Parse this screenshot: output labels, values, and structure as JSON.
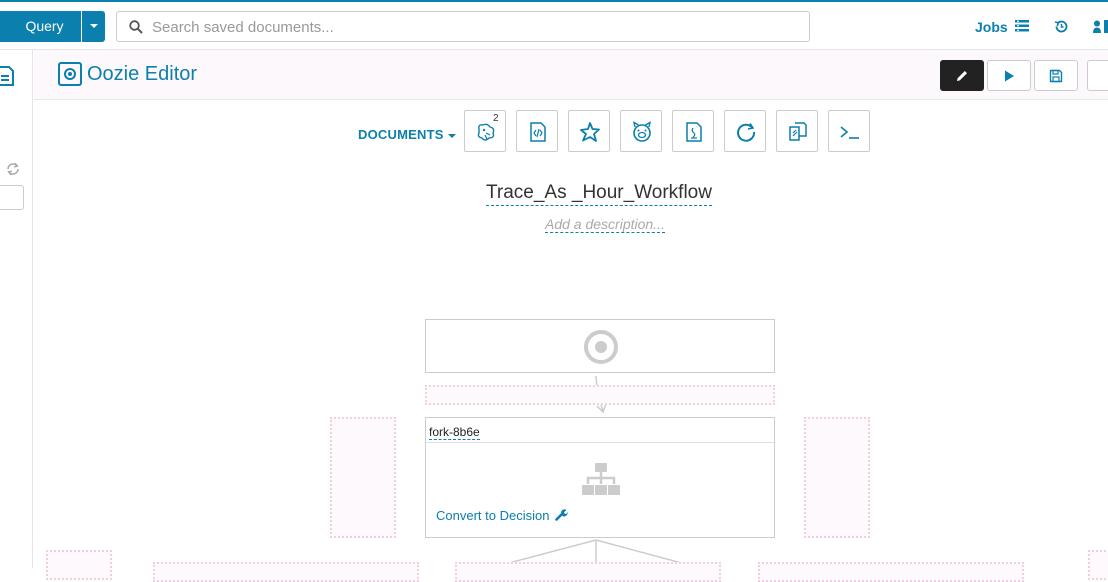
{
  "topbar": {
    "query_label": "Query",
    "search_placeholder": "Search saved documents...",
    "jobs_label": "Jobs"
  },
  "editor": {
    "title": "Oozie Editor"
  },
  "documents": {
    "label": "DOCUMENTS",
    "hive_badge": "2"
  },
  "workflow": {
    "name": "Trace_As _Hour_Workflow",
    "description_placeholder": "Add a description..."
  },
  "fork_node": {
    "name": "fork-8b6e",
    "convert_label": "Convert to Decision"
  },
  "colors": {
    "accent": "#0b7fad",
    "drop_zone_border": "#f1cfe1",
    "active_button": "#222222"
  }
}
